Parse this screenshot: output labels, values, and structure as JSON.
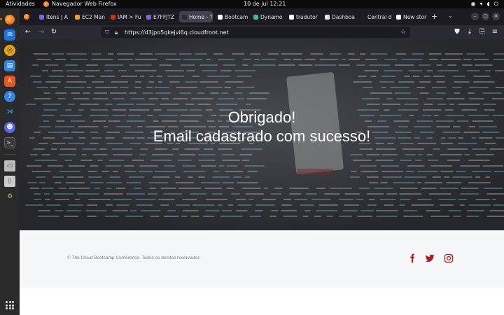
{
  "topbar": {
    "activities": "Atividades",
    "app_name": "Navegador Web Firefox",
    "clock": "10 de jul  12:21"
  },
  "browser": {
    "tabs": [
      {
        "label": "Itens | A",
        "color": "#6d6ae8"
      },
      {
        "label": "EC2 Man",
        "color": "#ff9900"
      },
      {
        "label": "IAM > Fu",
        "color": "#d13212"
      },
      {
        "label": "E7FFJTZ",
        "color": "#8a5cf6"
      },
      {
        "label": "Home - Th",
        "color": "#2b2a33",
        "active": true
      },
      {
        "label": "Bootcam",
        "color": "#ffffff"
      },
      {
        "label": "Dynamo",
        "color": "#3fbba4"
      },
      {
        "label": "tradutor",
        "color": "#ffffff"
      },
      {
        "label": "Dashboa",
        "color": "#e5e5e5"
      },
      {
        "label": "Central d",
        "color": "#1d1d24"
      },
      {
        "label": "New stor",
        "color": "#ffffff"
      }
    ],
    "url": "https://d3jpo5qkejvi6q.cloudfront.net"
  },
  "page": {
    "headline_line1": "Obrigado!",
    "headline_line2": "Email cadastrado com sucesso!",
    "copyright": "© The Cloud Bootcamp Conference. Todos os direitos reservados.",
    "social_color": "#b01c1c",
    "social": [
      "facebook-icon",
      "twitter-icon",
      "instagram-icon"
    ]
  }
}
